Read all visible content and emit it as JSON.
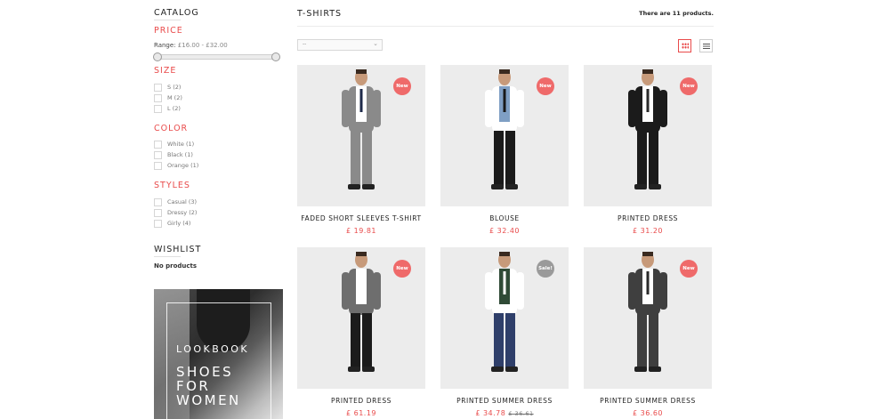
{
  "sidebar": {
    "catalog_title": "CATALOG",
    "price_title": "PRICE",
    "range_label": "Range:",
    "range_value": "£16.00 - £32.00",
    "size_title": "SIZE",
    "sizes": [
      "S (2)",
      "M (2)",
      "L (2)"
    ],
    "color_title": "COLOR",
    "colors": [
      "White (1)",
      "Black (1)",
      "Orange (1)"
    ],
    "styles_title": "STYLES",
    "styles": [
      "Casual (3)",
      "Dressy (2)",
      "Girly (4)"
    ],
    "wishlist_title": "WISHLIST",
    "wishlist_empty": "No products",
    "banner": {
      "line1": "LOOKBOOK",
      "line2": "SHOES",
      "line3": "FOR",
      "line4": "WOMEN"
    }
  },
  "main": {
    "title": "T-SHIRTS",
    "count_text": "There are 11 products.",
    "sort_value": "--",
    "accent": "#e94b4b"
  },
  "products": [
    {
      "name": "FADED SHORT SLEEVES T-SHIRT",
      "price": "£ 19.81",
      "old_price": "",
      "badge": "New",
      "badge_type": "new",
      "suit": "#8a8a8a",
      "inner": "#ffffff",
      "tie": "#1e2a4a",
      "pants": "#8a8a8a"
    },
    {
      "name": "BLOUSE",
      "price": "£ 32.40",
      "old_price": "",
      "badge": "New",
      "badge_type": "new",
      "suit": "#ffffff",
      "inner": "#7f9fc4",
      "tie": "#1a1a1a",
      "pants": "#1a1a1a"
    },
    {
      "name": "PRINTED DRESS",
      "price": "£ 31.20",
      "old_price": "",
      "badge": "New",
      "badge_type": "new",
      "suit": "#1b1b1b",
      "inner": "#ffffff",
      "tie": "#2a2a2a",
      "pants": "#1b1b1b"
    },
    {
      "name": "PRINTED DRESS",
      "price": "£ 61.19",
      "old_price": "",
      "badge": "New",
      "badge_type": "new",
      "suit": "#6e6e6e",
      "inner": "#ffffff",
      "tie": "#ffffff",
      "pants": "#1b1b1b"
    },
    {
      "name": "PRINTED SUMMER DRESS",
      "price": "£ 34.78",
      "old_price": "£ 36.61",
      "badge": "Sale!",
      "badge_type": "sale",
      "suit": "#ffffff",
      "inner": "#2f4a36",
      "tie": "#ffffff",
      "pants": "#2f3f6a"
    },
    {
      "name": "PRINTED SUMMER DRESS",
      "price": "£ 36.60",
      "old_price": "",
      "badge": "New",
      "badge_type": "new",
      "suit": "#3f3f3f",
      "inner": "#ffffff",
      "tie": "#2a2a2a",
      "pants": "#3f3f3f"
    }
  ]
}
